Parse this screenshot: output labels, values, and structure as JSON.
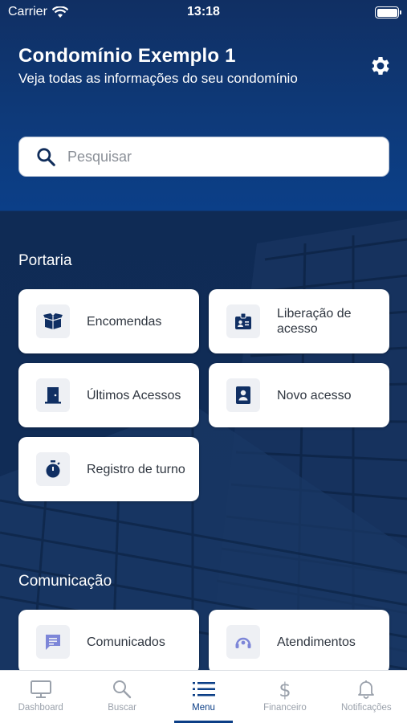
{
  "status_bar": {
    "carrier": "Carrier",
    "time": "13:18"
  },
  "header": {
    "title": "Condomínio Exemplo 1",
    "subtitle": "Veja todas as informações do seu condomínio"
  },
  "search": {
    "placeholder": "Pesquisar"
  },
  "sections": [
    {
      "title": "Portaria",
      "items": [
        {
          "label": "Encomendas",
          "icon": "package-icon"
        },
        {
          "label": "Liberação de acesso",
          "icon": "badge-icon"
        },
        {
          "label": "Últimos Acessos",
          "icon": "door-icon"
        },
        {
          "label": "Novo acesso",
          "icon": "id-card-icon"
        },
        {
          "label": "Registro de turno",
          "icon": "stopwatch-icon"
        }
      ]
    },
    {
      "title": "Comunicação",
      "items": [
        {
          "label": "Comunicados",
          "icon": "message-icon"
        },
        {
          "label": "Atendimentos",
          "icon": "support-icon"
        }
      ]
    }
  ],
  "tabbar": {
    "tabs": [
      {
        "label": "Dashboard",
        "icon": "monitor-icon"
      },
      {
        "label": "Buscar",
        "icon": "search-icon"
      },
      {
        "label": "Menu",
        "icon": "menu-icon",
        "active": true
      },
      {
        "label": "Financeiro",
        "icon": "dollar-icon"
      },
      {
        "label": "Notificações",
        "icon": "bell-icon"
      }
    ]
  },
  "colors": {
    "primary": "#0b3e86",
    "header_bg": "#102f63",
    "text_dark": "#2f3640",
    "tab_inactive": "#9aa1ab",
    "icon_accent": "#6f7fd6"
  }
}
